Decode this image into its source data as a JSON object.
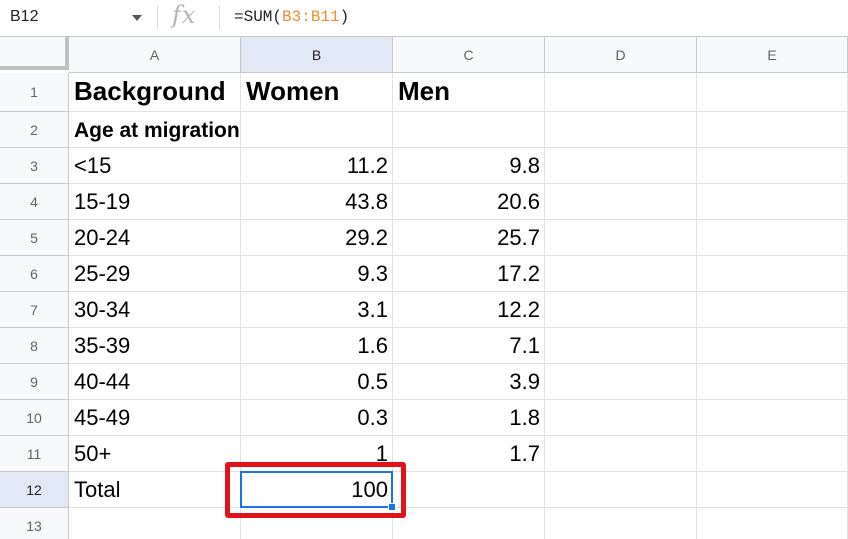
{
  "name_box": "B12",
  "fx_icon": "fx-icon",
  "formula": {
    "prefix": "=SUM(",
    "range": "B3:B11",
    "suffix": ")"
  },
  "columns": [
    "A",
    "B",
    "C",
    "D",
    "E"
  ],
  "rows": [
    "1",
    "2",
    "3",
    "4",
    "5",
    "6",
    "7",
    "8",
    "9",
    "10",
    "11",
    "12",
    "13"
  ],
  "cells": {
    "A1": "Background",
    "B1": "Women",
    "C1": "Men",
    "A2": "Age at migration",
    "A3": "<15",
    "B3": "11.2",
    "C3": "9.8",
    "A4": "15-19",
    "B4": "43.8",
    "C4": "20.6",
    "A5": "20-24",
    "B5": "29.2",
    "C5": "25.7",
    "A6": "25-29",
    "B6": "9.3",
    "C6": "17.2",
    "A7": "30-34",
    "B7": "3.1",
    "C7": "12.2",
    "A8": "35-39",
    "B8": "1.6",
    "C8": "7.1",
    "A9": "40-44",
    "B9": "0.5",
    "C9": "3.9",
    "A10": "45-49",
    "B10": "0.3",
    "C10": "1.8",
    "A11": "50+",
    "B11": "1",
    "C11": "1.7",
    "A12": "Total",
    "B12": "100"
  },
  "active_cell": "B12",
  "colors": {
    "selection": "#1a73e8",
    "highlight": "#e0131a",
    "formula_range": "#e8912d",
    "header_bg": "#f8f9fa",
    "active_header_bg": "#e1e9f7"
  }
}
